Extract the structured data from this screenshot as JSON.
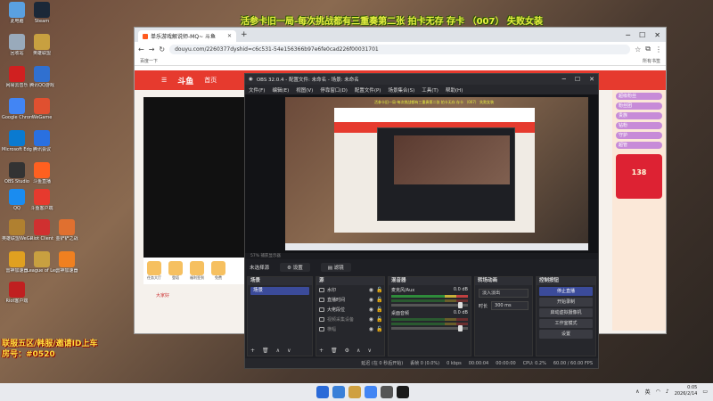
{
  "overlay": {
    "top_text": "活参卡旧一局-每次挑战都有三重奏第二张 拍卡无存 存卡 （007） 失败女装",
    "left_line1": "联服五区/韩服/邀请ID上车",
    "left_line2": "房号：#0520"
  },
  "desktop": {
    "icons": [
      {
        "label": "此电脑",
        "color": "#5aa0e0"
      },
      {
        "label": "Steam",
        "color": "#1b2838"
      },
      {
        "label": "回收站",
        "color": "#9ab"
      },
      {
        "label": "英雄联盟",
        "color": "#c8a040"
      },
      {
        "label": "网易云音乐",
        "color": "#d02020"
      },
      {
        "label": "腾讯QQ游戏",
        "color": "#3070d0"
      },
      {
        "label": "Google Chrome",
        "color": "#4285f4"
      },
      {
        "label": "WeGame",
        "color": "#e05030"
      },
      {
        "label": "Microsoft Edge",
        "color": "#0a7ad0"
      },
      {
        "label": "腾讯会议",
        "color": "#2a70e0"
      },
      {
        "label": "OBS Studio",
        "color": "#333"
      },
      {
        "label": "斗鱼直播",
        "color": "#ff6020"
      },
      {
        "label": "QQ",
        "color": "#1a8cf0"
      },
      {
        "label": "斗鱼客户端",
        "color": "#e63a2e"
      },
      {
        "label": "英雄联盟WeGame",
        "color": "#b08030"
      },
      {
        "label": "Riot Client",
        "color": "#d03030"
      },
      {
        "label": "金铲铲之战",
        "color": "#e07030"
      },
      {
        "label": "雷神加速器",
        "color": "#e0a020"
      },
      {
        "label": "League of Legends",
        "color": "#c8a040"
      },
      {
        "label": "雷神加速器",
        "color": "#f08020"
      },
      {
        "label": "Riot客户端",
        "color": "#c02020"
      }
    ]
  },
  "chrome": {
    "tab_title": "单乐游戏解说师-MQ~ 斗鱼",
    "url": "douyu.com/2260377dyshid=c6c531-54e156366b97e6fe0cad226f00031701",
    "bookmark": "百度一下",
    "bookmark_right": "所有书签",
    "site_logo": "斗鱼",
    "nav_home": "首页",
    "gift_labels": [
      "任务大厅",
      "登塔",
      "福利签到",
      "免费"
    ],
    "side_badges": [
      "超级粉丝",
      "粉丝团",
      "贵族",
      "钻粉",
      "守护",
      "超管"
    ],
    "promo_text": "138",
    "tag_line": "大家好"
  },
  "obs": {
    "title": "OBS 32.0.4 - 配置文件: 未命名 - 场景: 未命名",
    "menu": [
      "文件(F)",
      "编辑(E)",
      "视图(V)",
      "停靠窗口(D)",
      "配置文件(P)",
      "场景集合(S)",
      "工具(T)",
      "帮助(H)"
    ],
    "preview_bar": "57%   捕获显示器",
    "no_source": "未选择源",
    "props_btn": "设置",
    "filters_btn": "滤镜",
    "scenes_header": "场景",
    "scene_item": "场景",
    "sources_header": "源",
    "sources": [
      {
        "name": "水印",
        "dim": false
      },
      {
        "name": "直播时间",
        "dim": false
      },
      {
        "name": "大佬段位",
        "dim": false
      },
      {
        "name": "视频采集设备",
        "dim": true
      },
      {
        "name": "横幅",
        "dim": true
      }
    ],
    "mixer_header": "混音器",
    "mixer": [
      {
        "name": "麦克风/Aux",
        "db": "0.0 dB",
        "active": true
      },
      {
        "name": "桌面音频",
        "db": "0.0 dB",
        "active": false
      }
    ],
    "transitions_header": "转场动画",
    "transition": "淡入淡出",
    "duration_label": "时长",
    "duration": "300 ms",
    "controls_header": "控制按钮",
    "controls": [
      "停止直播",
      "开始录制",
      "启动虚拟摄像机",
      "工作室模式",
      "设置"
    ],
    "status": [
      "延迟 (在 0 秒后开始)",
      "丢帧 0 (0.0%)",
      "0 kbps",
      "00:00:04",
      "00:00:00",
      "CPU: 0.2%",
      "60.00 / 60.00 FPS"
    ]
  },
  "taskbar": {
    "lang": "英",
    "time": "0:05",
    "date": "2026/2/14",
    "apps": [
      "#3a80d8",
      "#cfa040",
      "#4285f4",
      "#555",
      "#1a1a1a"
    ]
  }
}
